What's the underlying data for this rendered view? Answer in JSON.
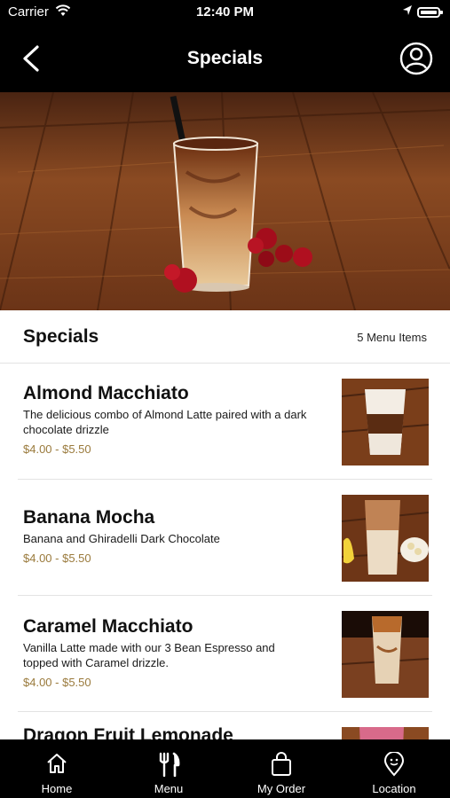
{
  "status_bar": {
    "carrier": "Carrier",
    "time": "12:40 PM"
  },
  "nav": {
    "title": "Specials",
    "back_icon": "chevron-left-icon",
    "profile_icon": "user-circle-icon"
  },
  "section": {
    "title": "Specials",
    "count": "5 Menu Items"
  },
  "items": [
    {
      "name": "Almond Macchiato",
      "description": "The delicious combo of Almond Latte paired with a dark chocolate drizzle",
      "price": "$4.00 - $5.50"
    },
    {
      "name": "Banana Mocha",
      "description": "Banana and Ghiradelli Dark Chocolate",
      "price": "$4.00 - $5.50"
    },
    {
      "name": "Caramel Macchiato",
      "description": "Vanilla Latte made with our 3 Bean Espresso and topped with Caramel drizzle.",
      "price": "$4.00 - $5.50"
    },
    {
      "name": "Dragon Fruit Lemonade",
      "description": "",
      "price": ""
    }
  ],
  "tabs": [
    {
      "label": "Home",
      "icon": "home-icon"
    },
    {
      "label": "Menu",
      "icon": "fork-knife-icon"
    },
    {
      "label": "My Order",
      "icon": "shopping-bag-icon"
    },
    {
      "label": "Location",
      "icon": "location-pin-icon"
    }
  ],
  "colors": {
    "bar": "#000000",
    "price": "#9a7a3c",
    "divider": "#e3e3e3"
  }
}
